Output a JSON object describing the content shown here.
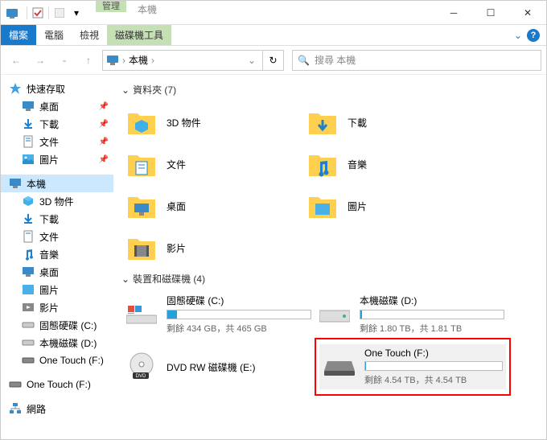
{
  "titlebar": {
    "manage_tab_top": "管理",
    "this_pc_tab": "本機"
  },
  "ribbon": {
    "file": "檔案",
    "computer": "電腦",
    "view": "檢視",
    "drive_tools": "磁碟機工具"
  },
  "addrbar": {
    "this_pc": "本機",
    "search_placeholder": "搜尋 本機"
  },
  "nav": {
    "quick_access": "快速存取",
    "desktop": "桌面",
    "downloads": "下載",
    "documents": "文件",
    "pictures": "圖片",
    "this_pc": "本機",
    "objects3d": "3D 物件",
    "downloads2": "下載",
    "documents2": "文件",
    "music": "音樂",
    "desktop2": "桌面",
    "pictures2": "圖片",
    "videos": "影片",
    "drive_c": "固態硬碟 (C:)",
    "drive_d": "本機磁碟 (D:)",
    "drive_f": "One Touch (F:)",
    "drive_f2": "One Touch (F:)",
    "network": "網路"
  },
  "main": {
    "folders_header": "資料夾 (7)",
    "drives_header": "裝置和磁碟機 (4)",
    "folders": {
      "objects3d": "3D 物件",
      "downloads": "下載",
      "documents": "文件",
      "music": "音樂",
      "desktop": "桌面",
      "pictures": "圖片",
      "videos": "影片"
    },
    "drives": {
      "c_name": "固態硬碟 (C:)",
      "c_stats": "剩餘 434 GB，共 465 GB",
      "d_name": "本機磁碟 (D:)",
      "d_stats": "剩餘 1.80 TB，共 1.81 TB",
      "dvd_name": "DVD RW 磁碟機 (E:)",
      "f_name": "One Touch (F:)",
      "f_stats": "剩餘 4.54 TB，共 4.54 TB"
    }
  }
}
